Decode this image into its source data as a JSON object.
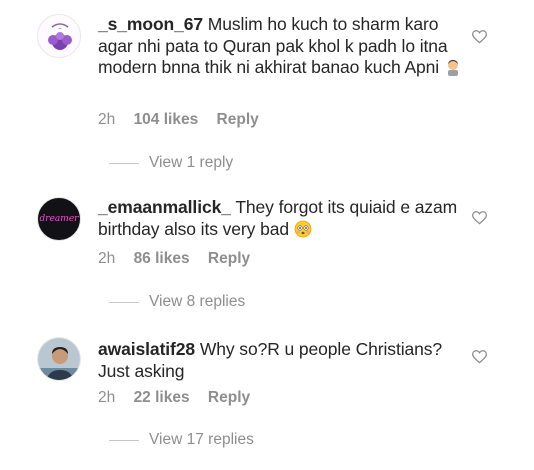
{
  "comments": [
    {
      "username": "_s_moon_67",
      "text": "Muslim ho kuch to sharm karo agar nhi pata to Quran pak khol k padh lo itna modern bnna thik ni akhirat banao kuch Apni",
      "time": "2h",
      "likes": "104 likes",
      "reply": "Reply",
      "view_replies": "View 1 reply",
      "emoji": "person-gesturing-emoji"
    },
    {
      "username": "_emaanmallick_",
      "text": "They forgot its quiaid e azam birthday also its very bad",
      "time": "2h",
      "likes": "86 likes",
      "reply": "Reply",
      "view_replies": "View 8 replies",
      "avatar_text": "dreamer",
      "emoji": "flushed-face-emoji"
    },
    {
      "username": "awaislatif28",
      "text": "Why so?R u people Christians? Just asking",
      "time": "2h",
      "likes": "22 likes",
      "reply": "Reply",
      "view_replies": "View 17 replies"
    }
  ],
  "colors": {
    "text": "#262626",
    "secondary": "#8e8e8e",
    "divider": "#c7c7c7"
  }
}
